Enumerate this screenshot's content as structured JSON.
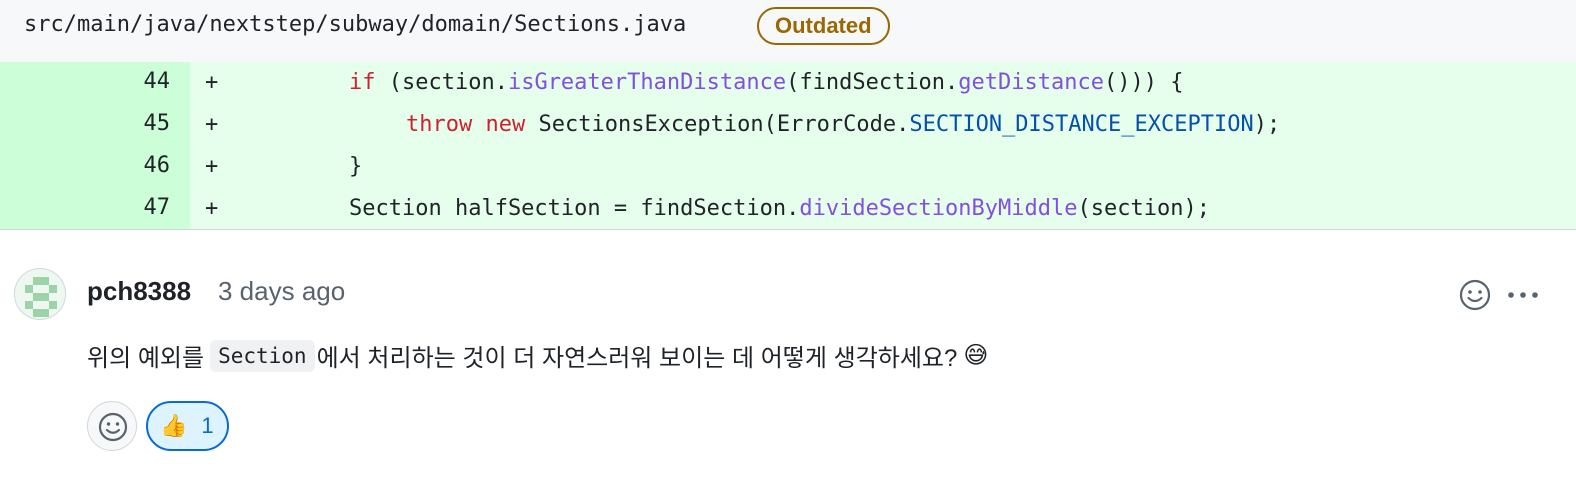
{
  "file": {
    "path": "src/main/java/nextstep/subway/domain/Sections.java",
    "badge": "Outdated"
  },
  "diff": {
    "rows": [
      {
        "line": "44",
        "marker": "+",
        "tokens": [
          {
            "t": "if",
            "c": "kw"
          },
          {
            "t": " (section.",
            "c": ""
          },
          {
            "t": "isGreaterThanDistance",
            "c": "fn"
          },
          {
            "t": "(findSection.",
            "c": ""
          },
          {
            "t": "getDistance",
            "c": "fn"
          },
          {
            "t": "())) {",
            "c": ""
          }
        ]
      },
      {
        "line": "45",
        "marker": "+",
        "tokens": [
          {
            "t": "throw",
            "c": "kw"
          },
          {
            "t": " ",
            "c": ""
          },
          {
            "t": "new",
            "c": "kw"
          },
          {
            "t": " SectionsException(ErrorCode.",
            "c": ""
          },
          {
            "t": "SECTION_DISTANCE_EXCEPTION",
            "c": "cst"
          },
          {
            "t": ");",
            "c": ""
          }
        ]
      },
      {
        "line": "46",
        "marker": "+",
        "tokens": [
          {
            "t": "}",
            "c": ""
          }
        ]
      },
      {
        "line": "47",
        "marker": "+",
        "tokens": [
          {
            "t": "Section halfSection = findSection.",
            "c": ""
          },
          {
            "t": "divideSectionByMiddle",
            "c": "fn"
          },
          {
            "t": "(section);",
            "c": ""
          }
        ]
      }
    ]
  },
  "comment": {
    "author": "pch8388",
    "time": "3 days ago",
    "body_before": "위의 예외를",
    "body_code": "Section",
    "body_after": "에서 처리하는 것이 더 자연스러워 보이는 데 어떻게 생각하세요?",
    "body_emoji": "😅"
  },
  "reactions": {
    "thumbs_emoji": "👍",
    "thumbs_count": "1"
  },
  "icons": {
    "smiley": "smiley-icon",
    "more": "kebab-horizontal-icon",
    "add_reaction": "add-reaction-smiley-icon"
  },
  "colors": {
    "addition_gutter": "#ccffd8",
    "addition_line": "#e6ffec",
    "outdated": "#9a6700",
    "reaction_accent": "#0969da"
  }
}
